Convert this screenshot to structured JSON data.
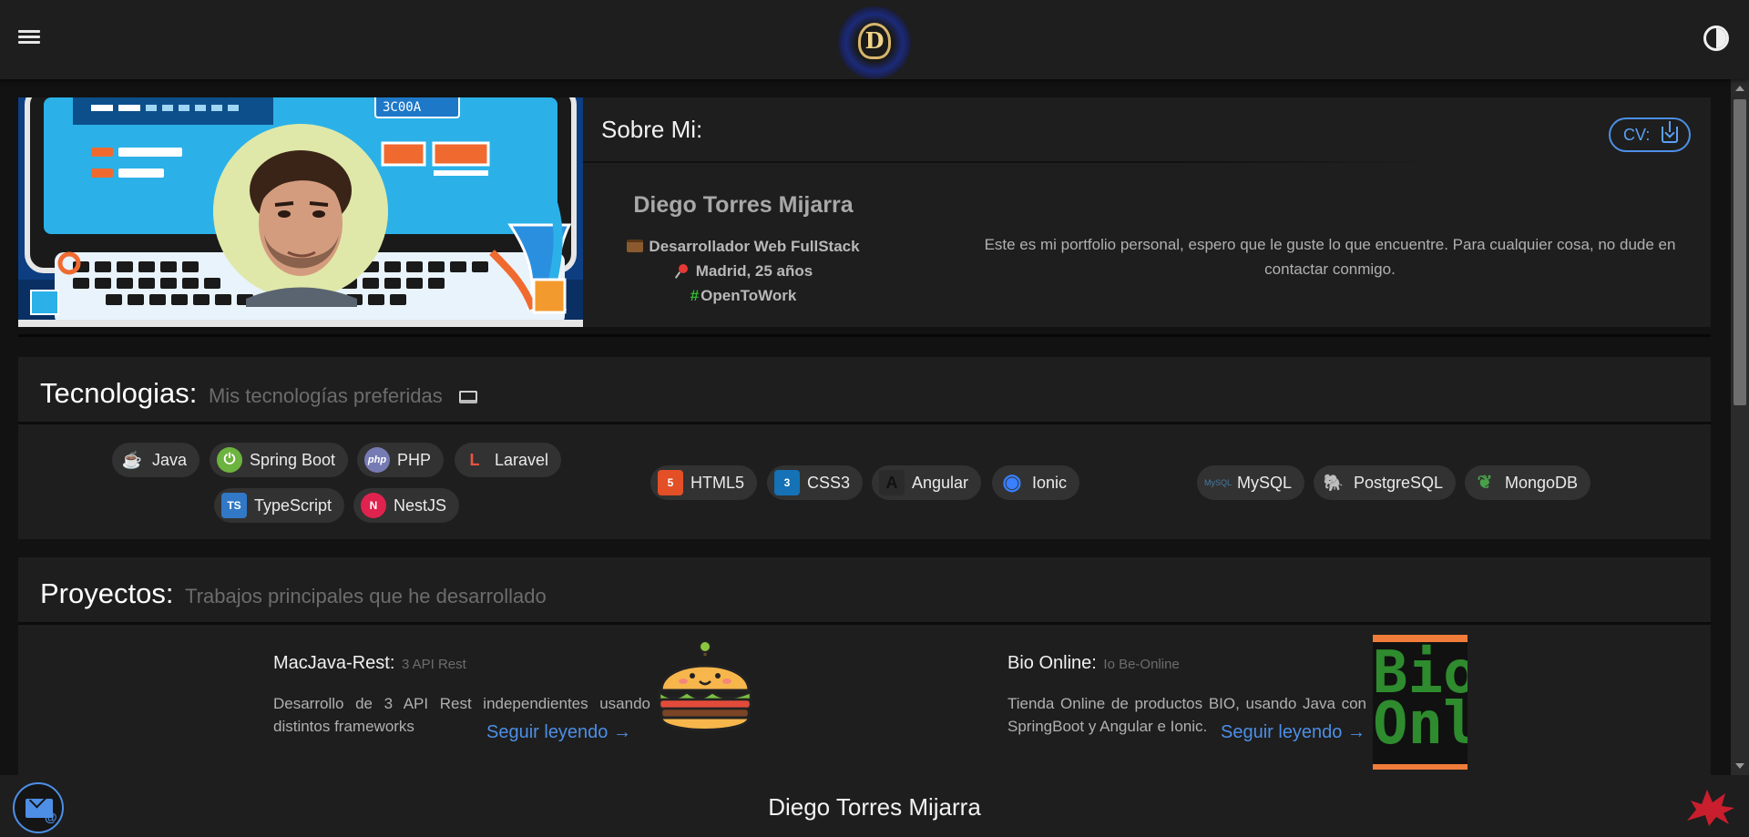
{
  "header": {
    "logo_letter": "D"
  },
  "about": {
    "heading": "Sobre Mi:",
    "cv_label": "CV:",
    "name": "Diego Torres Mijarra",
    "role": "Desarrollador Web FullStack",
    "location": "Madrid, 25 años",
    "status": "OpenToWork",
    "description": "Este es mi portfolio personal, espero que le guste lo que encuentre. Para cualquier cosa, no dude en contactar conmigo.",
    "banner_screen_text": "3C00A"
  },
  "technologies": {
    "title": "Tecnologias:",
    "subtitle": "Mis tecnologías preferidas",
    "backend": [
      {
        "label": "Java",
        "icon": "java-icon",
        "color": "#e76f00"
      },
      {
        "label": "Spring Boot",
        "icon": "spring-boot-icon",
        "color": "#6db33f"
      },
      {
        "label": "PHP",
        "icon": "php-icon",
        "color": "#777bb4"
      },
      {
        "label": "Laravel",
        "icon": "laravel-icon",
        "color": "#f05340"
      },
      {
        "label": "TypeScript",
        "icon": "typescript-icon",
        "color": "#3178c6"
      },
      {
        "label": "NestJS",
        "icon": "nestjs-icon",
        "color": "#e0234e"
      }
    ],
    "frontend": [
      {
        "label": "HTML5",
        "icon": "html5-icon",
        "color": "#e34f26"
      },
      {
        "label": "CSS3",
        "icon": "css3-icon",
        "color": "#1572b6"
      },
      {
        "label": "Angular",
        "icon": "angular-icon",
        "color": "#2b2b2b"
      },
      {
        "label": "Ionic",
        "icon": "ionic-icon",
        "color": "#3880ff"
      }
    ],
    "databases": [
      {
        "label": "MySQL",
        "icon": "mysql-icon",
        "color": "#4479a1"
      },
      {
        "label": "PostgreSQL",
        "icon": "postgresql-icon",
        "color": "#336791"
      },
      {
        "label": "MongoDB",
        "icon": "mongodb-icon",
        "color": "#47a248"
      }
    ],
    "icon_text": {
      "java": "☕",
      "spring": "⏻",
      "php": "php",
      "laravel": "L",
      "ts": "TS",
      "nest": "N",
      "html": "5",
      "css": "3",
      "angular": "A",
      "ionic": "◉",
      "mysql": "MySQL",
      "postgres": "🐘",
      "mongo": "❦"
    }
  },
  "projects": {
    "title": "Proyectos:",
    "subtitle": "Trabajos principales que he desarrollado",
    "items": [
      {
        "title": "MacJava-Rest:",
        "tag": "3 API Rest",
        "description": "Desarrollo de 3 API Rest independientes usando distintos frameworks",
        "link": "Seguir leyendo →"
      },
      {
        "title": "Bio Online:",
        "tag": "Io Be-Online",
        "description": "Tienda Online de productos BIO, usando Java con SpringBoot y Angular e Ionic.",
        "link": "Seguir leyendo →",
        "image_text": "Bio Onlin"
      }
    ]
  },
  "footer": {
    "name": "Diego Torres Mijarra",
    "mail_symbol": "@"
  },
  "colors": {
    "accent": "#4d8fe6",
    "background": "#121212",
    "surface": "#1e1e1e",
    "chip": "#323232",
    "open_to_work": "#2eb82e"
  }
}
